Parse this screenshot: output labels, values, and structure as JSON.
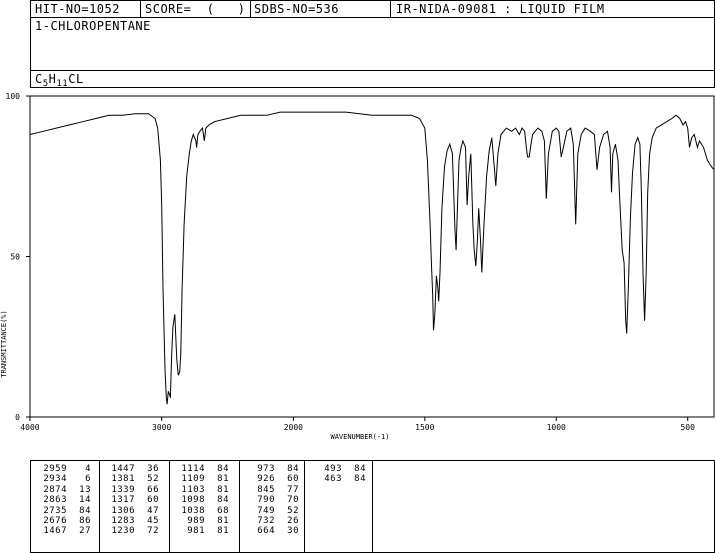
{
  "header": {
    "hit_no": "HIT-NO=1052",
    "score": "SCORE=  (   )",
    "sdbs_no": "SDBS-NO=536",
    "ir_no": "IR-NIDA-09081 : LIQUID FILM"
  },
  "compound": {
    "name": "1-CHLOROPENTANE",
    "formula_c": "C",
    "formula_c_sub": "5",
    "formula_h": "H",
    "formula_h_sub": "11",
    "formula_rest": "CL"
  },
  "chart_data": {
    "type": "line",
    "xlabel": "WAVENUMBER(-1)",
    "ylabel": "TRANSMITTANCE(%)",
    "xlim": [
      4000,
      400
    ],
    "ylim": [
      0,
      100
    ],
    "x_ticks": [
      4000,
      3000,
      2000,
      1500,
      1000,
      500
    ],
    "y_ticks": [
      0,
      50,
      100
    ],
    "grid": false,
    "series": [
      {
        "points": [
          [
            4000,
            88
          ],
          [
            3900,
            89
          ],
          [
            3800,
            90
          ],
          [
            3700,
            91
          ],
          [
            3600,
            92
          ],
          [
            3500,
            93
          ],
          [
            3400,
            94
          ],
          [
            3300,
            94
          ],
          [
            3200,
            94.5
          ],
          [
            3100,
            94.5
          ],
          [
            3050,
            93
          ],
          [
            3030,
            90
          ],
          [
            3010,
            80
          ],
          [
            3000,
            66
          ],
          [
            2990,
            40
          ],
          [
            2975,
            15
          ],
          [
            2965,
            6
          ],
          [
            2959,
            4
          ],
          [
            2950,
            8
          ],
          [
            2940,
            7
          ],
          [
            2934,
            6
          ],
          [
            2925,
            18
          ],
          [
            2915,
            28
          ],
          [
            2900,
            32
          ],
          [
            2890,
            22
          ],
          [
            2885,
            18
          ],
          [
            2874,
            13
          ],
          [
            2863,
            14
          ],
          [
            2855,
            20
          ],
          [
            2845,
            40
          ],
          [
            2830,
            60
          ],
          [
            2810,
            75
          ],
          [
            2790,
            82
          ],
          [
            2775,
            86
          ],
          [
            2760,
            88
          ],
          [
            2740,
            86
          ],
          [
            2735,
            84
          ],
          [
            2725,
            88
          ],
          [
            2710,
            89
          ],
          [
            2690,
            90
          ],
          [
            2676,
            86
          ],
          [
            2665,
            90
          ],
          [
            2640,
            91
          ],
          [
            2600,
            92
          ],
          [
            2500,
            93
          ],
          [
            2400,
            94
          ],
          [
            2300,
            94
          ],
          [
            2200,
            94
          ],
          [
            2100,
            95
          ],
          [
            2000,
            95
          ],
          [
            1900,
            95
          ],
          [
            1800,
            95
          ],
          [
            1700,
            94
          ],
          [
            1600,
            94
          ],
          [
            1550,
            94
          ],
          [
            1520,
            93
          ],
          [
            1500,
            90
          ],
          [
            1490,
            80
          ],
          [
            1480,
            60
          ],
          [
            1475,
            48
          ],
          [
            1470,
            38
          ],
          [
            1467,
            27
          ],
          [
            1462,
            32
          ],
          [
            1456,
            44
          ],
          [
            1450,
            40
          ],
          [
            1447,
            36
          ],
          [
            1442,
            45
          ],
          [
            1435,
            65
          ],
          [
            1425,
            78
          ],
          [
            1415,
            83
          ],
          [
            1405,
            85
          ],
          [
            1395,
            82
          ],
          [
            1390,
            70
          ],
          [
            1385,
            58
          ],
          [
            1381,
            52
          ],
          [
            1376,
            65
          ],
          [
            1370,
            80
          ],
          [
            1362,
            84
          ],
          [
            1355,
            86
          ],
          [
            1345,
            84
          ],
          [
            1339,
            66
          ],
          [
            1333,
            75
          ],
          [
            1325,
            82
          ],
          [
            1317,
            60
          ],
          [
            1312,
            52
          ],
          [
            1306,
            47
          ],
          [
            1300,
            55
          ],
          [
            1295,
            65
          ],
          [
            1288,
            55
          ],
          [
            1283,
            45
          ],
          [
            1275,
            60
          ],
          [
            1265,
            75
          ],
          [
            1255,
            83
          ],
          [
            1245,
            87
          ],
          [
            1238,
            80
          ],
          [
            1230,
            72
          ],
          [
            1222,
            82
          ],
          [
            1210,
            88
          ],
          [
            1190,
            90
          ],
          [
            1170,
            89
          ],
          [
            1155,
            90
          ],
          [
            1140,
            88
          ],
          [
            1130,
            90
          ],
          [
            1120,
            89
          ],
          [
            1114,
            84
          ],
          [
            1109,
            81
          ],
          [
            1103,
            81
          ],
          [
            1098,
            84
          ],
          [
            1090,
            88
          ],
          [
            1070,
            90
          ],
          [
            1055,
            89
          ],
          [
            1045,
            86
          ],
          [
            1038,
            68
          ],
          [
            1030,
            82
          ],
          [
            1015,
            89
          ],
          [
            1000,
            90
          ],
          [
            990,
            89
          ],
          [
            981,
            81
          ],
          [
            973,
            84
          ],
          [
            960,
            89
          ],
          [
            945,
            90
          ],
          [
            935,
            85
          ],
          [
            926,
            60
          ],
          [
            918,
            82
          ],
          [
            905,
            88
          ],
          [
            890,
            90
          ],
          [
            870,
            89
          ],
          [
            855,
            88
          ],
          [
            845,
            77
          ],
          [
            835,
            84
          ],
          [
            820,
            88
          ],
          [
            805,
            89
          ],
          [
            795,
            84
          ],
          [
            790,
            70
          ],
          [
            785,
            82
          ],
          [
            775,
            85
          ],
          [
            765,
            80
          ],
          [
            760,
            70
          ],
          [
            749,
            52
          ],
          [
            742,
            48
          ],
          [
            736,
            30
          ],
          [
            732,
            26
          ],
          [
            726,
            40
          ],
          [
            718,
            62
          ],
          [
            710,
            76
          ],
          [
            700,
            85
          ],
          [
            690,
            87
          ],
          [
            682,
            85
          ],
          [
            676,
            70
          ],
          [
            670,
            45
          ],
          [
            664,
            30
          ],
          [
            658,
            45
          ],
          [
            652,
            70
          ],
          [
            645,
            82
          ],
          [
            635,
            87
          ],
          [
            620,
            90
          ],
          [
            600,
            91
          ],
          [
            580,
            92
          ],
          [
            560,
            93
          ],
          [
            545,
            94
          ],
          [
            530,
            93
          ],
          [
            518,
            91
          ],
          [
            508,
            92
          ],
          [
            500,
            90
          ],
          [
            493,
            84
          ],
          [
            485,
            87
          ],
          [
            475,
            88
          ],
          [
            463,
            84
          ],
          [
            455,
            86
          ],
          [
            440,
            84
          ],
          [
            425,
            80
          ],
          [
            410,
            78
          ],
          [
            400,
            77
          ]
        ]
      }
    ]
  },
  "peak_table": {
    "columns": [
      [
        [
          "2959",
          "4"
        ],
        [
          "2934",
          "6"
        ],
        [
          "2874",
          "13"
        ],
        [
          "2863",
          "14"
        ],
        [
          "2735",
          "84"
        ],
        [
          "2676",
          "86"
        ],
        [
          "1467",
          "27"
        ]
      ],
      [
        [
          "1447",
          "36"
        ],
        [
          "1381",
          "52"
        ],
        [
          "1339",
          "66"
        ],
        [
          "1317",
          "60"
        ],
        [
          "1306",
          "47"
        ],
        [
          "1283",
          "45"
        ],
        [
          "1230",
          "72"
        ]
      ],
      [
        [
          "1114",
          "84"
        ],
        [
          "1109",
          "81"
        ],
        [
          "1103",
          "81"
        ],
        [
          "1098",
          "84"
        ],
        [
          "1038",
          "68"
        ],
        [
          "989",
          "81"
        ],
        [
          "981",
          "81"
        ]
      ],
      [
        [
          "973",
          "84"
        ],
        [
          "926",
          "60"
        ],
        [
          "845",
          "77"
        ],
        [
          "790",
          "70"
        ],
        [
          "749",
          "52"
        ],
        [
          "732",
          "26"
        ],
        [
          "664",
          "30"
        ]
      ],
      [
        [
          "493",
          "84"
        ],
        [
          "463",
          "84"
        ]
      ]
    ]
  }
}
